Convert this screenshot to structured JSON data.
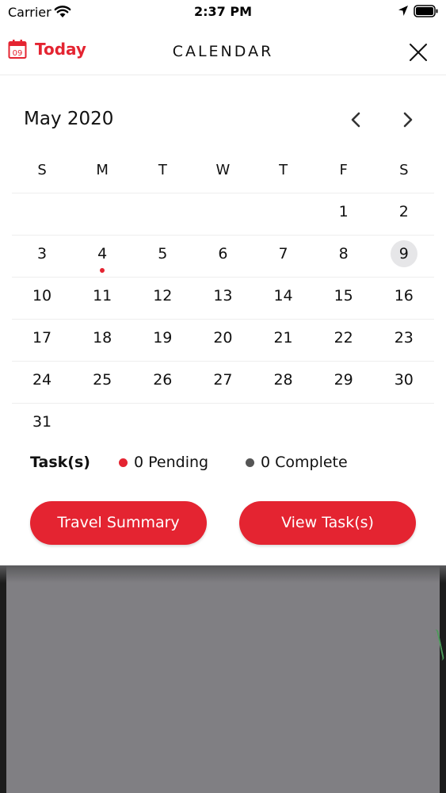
{
  "status_bar": {
    "carrier": "Carrier",
    "time": "2:37 PM"
  },
  "header": {
    "today_icon_text": "09",
    "today_label": "Today",
    "title": "CALENDAR"
  },
  "calendar": {
    "month_label": "May 2020",
    "weekdays": [
      "S",
      "M",
      "T",
      "W",
      "T",
      "F",
      "S"
    ],
    "weeks": [
      [
        "",
        "",
        "",
        "",
        "",
        "1",
        "2"
      ],
      [
        "3",
        "4",
        "5",
        "6",
        "7",
        "8",
        "9"
      ],
      [
        "10",
        "11",
        "12",
        "13",
        "14",
        "15",
        "16"
      ],
      [
        "17",
        "18",
        "19",
        "20",
        "21",
        "22",
        "23"
      ],
      [
        "24",
        "25",
        "26",
        "27",
        "28",
        "29",
        "30"
      ],
      [
        "31",
        "",
        "",
        "",
        "",
        "",
        ""
      ]
    ],
    "selected_day": "9",
    "event_days": [
      "4"
    ]
  },
  "legend": {
    "title": "Task(s)",
    "pending": "0 Pending",
    "complete": "0 Complete"
  },
  "buttons": {
    "travel_summary": "Travel Summary",
    "view_tasks": "View Task(s)"
  },
  "colors": {
    "accent": "#e42431",
    "complete_dot": "#555555",
    "selected_bg": "#e6e6e8"
  }
}
